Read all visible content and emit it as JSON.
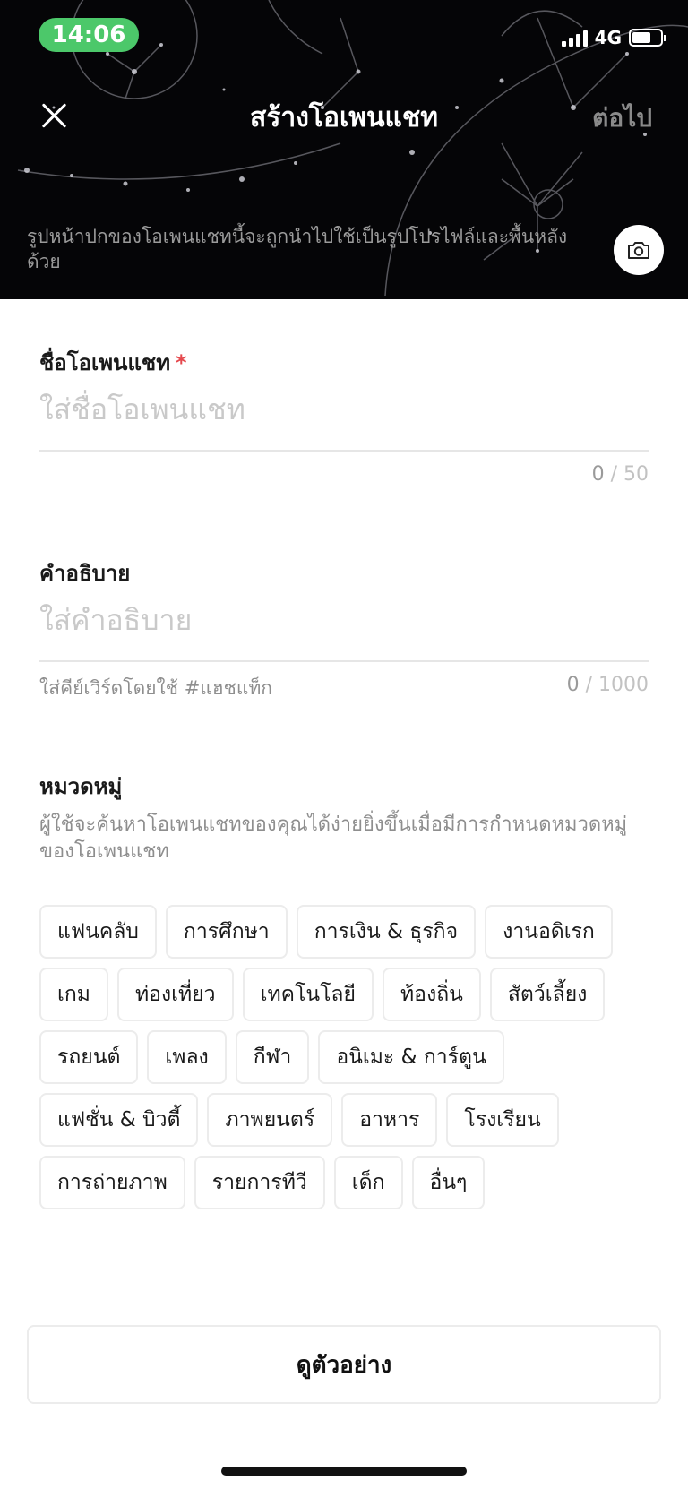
{
  "status_bar": {
    "time": "14:06",
    "network": "4G",
    "battery_level": 0.65
  },
  "header": {
    "title": "สร้างโอเพนแชท",
    "next_label": "ต่อไป",
    "cover_caption": "รูปหน้าปกของโอเพนแชทนี้จะถูกนำไปใช้เป็นรูปโปรไฟล์และพื้นหลังด้วย"
  },
  "name_field": {
    "label": "ชื่อโอเพนแชท",
    "required_mark": "*",
    "value": "",
    "placeholder": "ใส่ชื่อโอเพนแชท",
    "count": "0",
    "max": "/ 50"
  },
  "description_field": {
    "label": "คำอธิบาย",
    "value": "",
    "placeholder": "ใส่คำอธิบาย",
    "hint": "ใส่คีย์เวิร์ดโดยใช้ #แฮชแท็ก",
    "count": "0",
    "max": "/ 1000"
  },
  "category": {
    "label": "หมวดหมู่",
    "description": "ผู้ใช้จะค้นหาโอเพนแชทของคุณได้ง่ายยิ่งขึ้นเมื่อมีการกำหนดหมวดหมู่ของโอเพนแชท",
    "rows": [
      [
        "แฟนคลับ",
        "การศึกษา",
        "การเงิน & ธุรกิจ",
        "งานอดิเรก"
      ],
      [
        "เกม",
        "ท่องเที่ยว",
        "เทคโนโลยี",
        "ท้องถิ่น",
        "สัตว์เลี้ยง"
      ],
      [
        "รถยนต์",
        "เพลง",
        "กีฬา",
        "อนิเมะ & การ์ตูน"
      ],
      [
        "แฟชั่น & บิวตี้",
        "ภาพยนตร์",
        "อาหาร",
        "โรงเรียน"
      ],
      [
        "การถ่ายภาพ",
        "รายการทีวี",
        "เด็ก",
        "อื่นๆ"
      ]
    ]
  },
  "preview_button": {
    "label": "ดูตัวอย่าง"
  }
}
